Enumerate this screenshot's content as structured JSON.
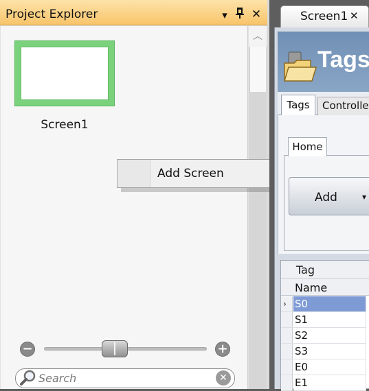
{
  "project_explorer": {
    "title": "Project Explorer",
    "screens": [
      {
        "label": "Screen1"
      }
    ],
    "context_menu": {
      "items": [
        {
          "label": "Add Screen"
        }
      ]
    },
    "zoom": {
      "minus": "−",
      "plus": "+",
      "level": 0.45
    },
    "search": {
      "placeholder": "Search",
      "value": ""
    }
  },
  "document": {
    "tab": {
      "label": "Screen1",
      "close": "✕"
    },
    "header": {
      "title": "Tags"
    },
    "subtabs": [
      "Tags",
      "Controller"
    ],
    "ribbon": {
      "tab": "Home",
      "add_label": "Add"
    },
    "grid": {
      "group_header": "Tag",
      "column_header": "Name",
      "rows": [
        "S0",
        "S1",
        "S2",
        "S3",
        "E0",
        "E1"
      ],
      "selected_row": 0
    }
  },
  "colors": {
    "titlebar": "#f8c46a",
    "thumb_border": "#7ad27c",
    "selection": "#7f9bd6",
    "tags_header": "#7f9bbd"
  },
  "icons": [
    "dropdown-icon",
    "pin-icon",
    "close-icon",
    "scroll-up-icon",
    "zoom-out-icon",
    "zoom-in-icon",
    "search-icon",
    "clear-icon",
    "tags-folder-icon",
    "row-pointer-icon"
  ]
}
